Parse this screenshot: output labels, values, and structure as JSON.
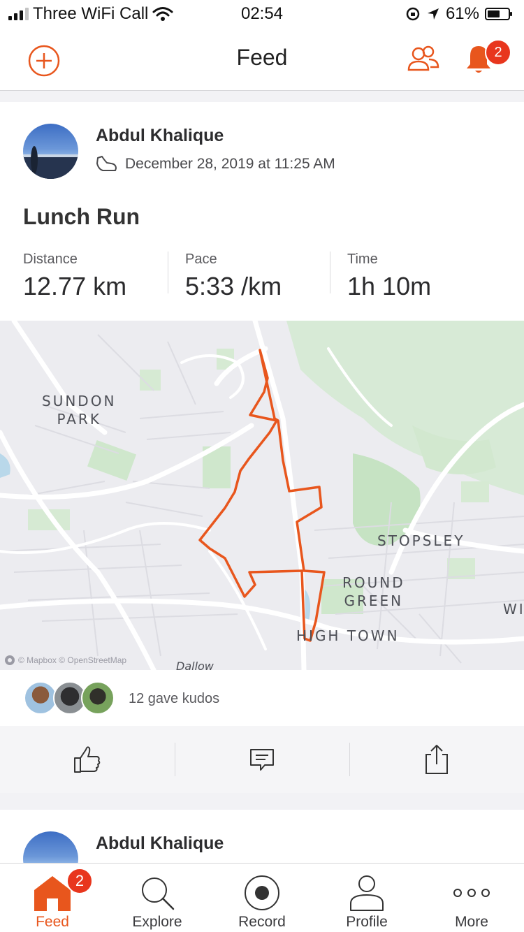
{
  "status_bar": {
    "carrier": "Three WiFi Call",
    "time": "02:54",
    "battery": "61%",
    "battery_level": 0.61
  },
  "header": {
    "title": "Feed",
    "notification_count": "2"
  },
  "activity": {
    "athlete": "Abdul Khalique",
    "datetime": "December 28, 2019 at 11:25 AM",
    "title": "Lunch Run",
    "stats": [
      {
        "label": "Distance",
        "value": "12.77 km"
      },
      {
        "label": "Pace",
        "value": "5:33 /km"
      },
      {
        "label": "Time",
        "value": "1h 10m"
      }
    ],
    "map": {
      "places": [
        "SUNDON\nPARK",
        "STOPSLEY",
        "ROUND\nGREEN",
        "HIGH TOWN",
        "WI",
        "Dallow"
      ],
      "attribution": "© Mapbox © OpenStreetMap",
      "route_color": "#e8561d"
    },
    "kudos": "12 gave kudos"
  },
  "next_activity": {
    "athlete": "Abdul Khalique"
  },
  "tabs": [
    {
      "label": "Feed",
      "icon": "home-icon",
      "badge": "2",
      "active": true
    },
    {
      "label": "Explore",
      "icon": "search-icon"
    },
    {
      "label": "Record",
      "icon": "record-icon"
    },
    {
      "label": "Profile",
      "icon": "person-icon"
    },
    {
      "label": "More",
      "icon": "more-dots-icon"
    }
  ],
  "colors": {
    "accent": "#e8561d",
    "badge": "#e8361d"
  }
}
